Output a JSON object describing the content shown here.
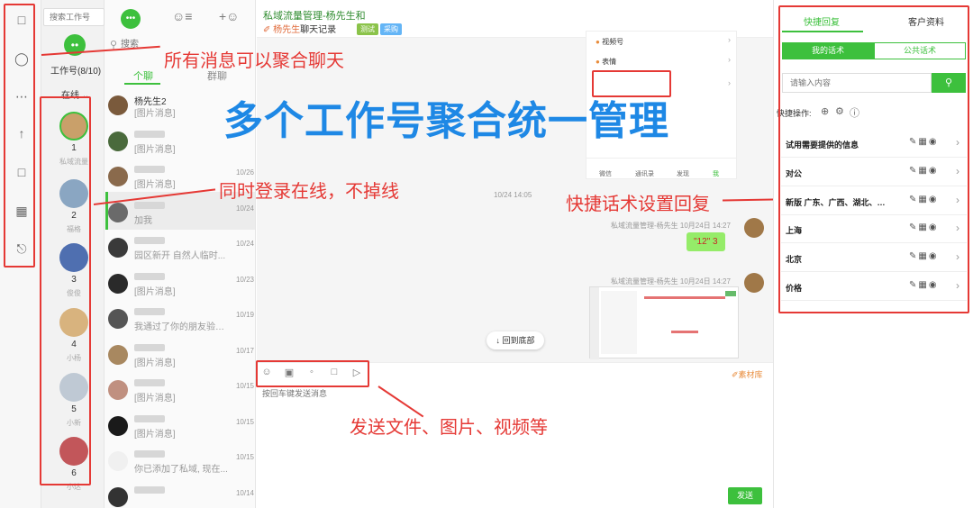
{
  "search_accounts_placeholder": "搜索工作号",
  "accounts_header": "工作号(8/10)",
  "online_filter": "在线",
  "chat_search_placeholder": "搜索",
  "tabs": [
    "个聊",
    "群聊"
  ],
  "accounts": [
    {
      "num": "1",
      "name": "私域流量",
      "color": "#c9a06a"
    },
    {
      "num": "2",
      "name": "福格",
      "color": "#8aa6c2"
    },
    {
      "num": "3",
      "name": "俊俊",
      "color": "#4f6fb0"
    },
    {
      "num": "4",
      "name": "小杨",
      "color": "#d8b37e"
    },
    {
      "num": "5",
      "name": "小新",
      "color": "#bfc9d4"
    },
    {
      "num": "6",
      "name": "小达",
      "color": "#c2565a"
    }
  ],
  "chats": [
    {
      "name": "杨先生2",
      "preview": "[图片消息]",
      "date": "",
      "color": "#7a5a3c"
    },
    {
      "name": "",
      "preview": "[图片消息]",
      "date": "",
      "color": "#4a6a3c"
    },
    {
      "name": "",
      "preview": "[图片消息]",
      "date": "10/26",
      "color": "#8a6a4c"
    },
    {
      "name": "",
      "preview": "加我",
      "date": "10/24",
      "color": "#6a6a6a"
    },
    {
      "name": "",
      "preview": "园区新开 自然人临时...",
      "date": "10/24",
      "color": "#3a3a3a"
    },
    {
      "name": "",
      "preview": "[图片消息]",
      "date": "10/23",
      "color": "#2a2a2a"
    },
    {
      "name": "",
      "preview": "我通过了你的朋友验证...",
      "date": "10/19",
      "color": "#555555"
    },
    {
      "name": "",
      "preview": "[图片消息]",
      "date": "10/17",
      "color": "#a88860"
    },
    {
      "name": "",
      "preview": "[图片消息]",
      "date": "10/15",
      "color": "#c09080"
    },
    {
      "name": "",
      "preview": "[图片消息]",
      "date": "10/15",
      "color": "#1a1a1a"
    },
    {
      "name": "",
      "preview": "你已添加了私域, 现在...",
      "date": "10/15",
      "color": "#f0f0f0"
    },
    {
      "name": "",
      "preview": "",
      "date": "10/14",
      "color": "#333333"
    }
  ],
  "header": {
    "title": "私域流量管理-杨先生和",
    "sub_name": "杨先生",
    "sub_text": "聊天记录",
    "tag1": "测试",
    "tag2": "采购"
  },
  "phone_menu": [
    "视频号",
    "表情"
  ],
  "phone_tabs": [
    "微信",
    "通讯录",
    "发现",
    "我"
  ],
  "center_time": "10/24 14:05",
  "msg1_meta": "私域流量管理-杨先生 10月24日 14:27",
  "msg1_text": "\"12\" 3",
  "msg2_meta": "私域流量管理-杨先生 10月24日 14:27",
  "back_bottom": "回到底部",
  "material_lib": "素材库",
  "input_placeholder": "按回车键发送消息",
  "send_label": "发送",
  "right_tabs": [
    "快捷回复",
    "客户资料"
  ],
  "sub_tabs": [
    "我的话术",
    "公共话术"
  ],
  "quick_search_placeholder": "请输入内容",
  "quick_ops_label": "快捷操作:",
  "quick_items": [
    "试用需要提供的信息",
    "对公",
    "新版 广东、广西、湖北、湖南...",
    "上海",
    "北京",
    "价格"
  ],
  "ann": {
    "title": "多个工作号聚合统一管理",
    "a1": "所有消息可以聚合聊天",
    "a2": "同时登录在线，不掉线",
    "a3": "快捷话术设置回复",
    "a4": "发送文件、图片、视频等"
  }
}
